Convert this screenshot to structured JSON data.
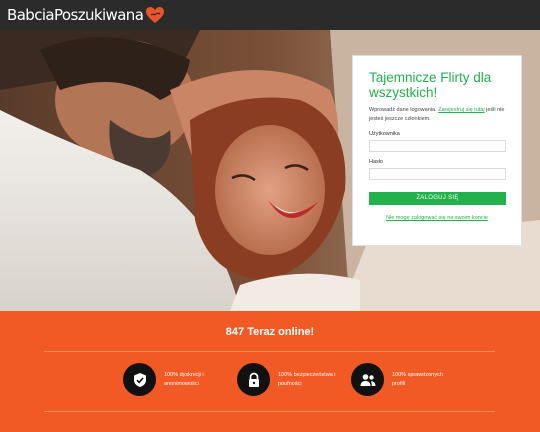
{
  "header": {
    "logo_text": "BabciaPoszukiwana",
    "logo_icon": "heart-icon",
    "accent_color": "#e8552a"
  },
  "hero": {
    "image_description_icon": "couple-photo"
  },
  "login": {
    "title": "Tajemnicze Flirty dla wszystkich!",
    "info_prefix": "Wprowadź dane logowania.",
    "info_link": "Zarejestruj się tutaj",
    "info_suffix": "jeśli nie jesteś jeszcze członkiem.",
    "username_label": "Użytkownika",
    "username_value": "",
    "password_label": "Hasło",
    "password_value": "",
    "submit_label": "ZALOGUJ SIĘ",
    "forgot_link": "Nie mogę zalogować się na swoim koncie",
    "accent_color": "#22b14c"
  },
  "footer": {
    "online_text": "847 Teraz online!",
    "band_color": "#f15a24",
    "features": [
      {
        "icon": "shield-check-icon",
        "text": "100% dyskrecji i anonimowości"
      },
      {
        "icon": "lock-icon",
        "text": "100% bezpieczeństwa i poufności"
      },
      {
        "icon": "users-icon",
        "text": "100% sprawdzonych profili"
      }
    ]
  }
}
